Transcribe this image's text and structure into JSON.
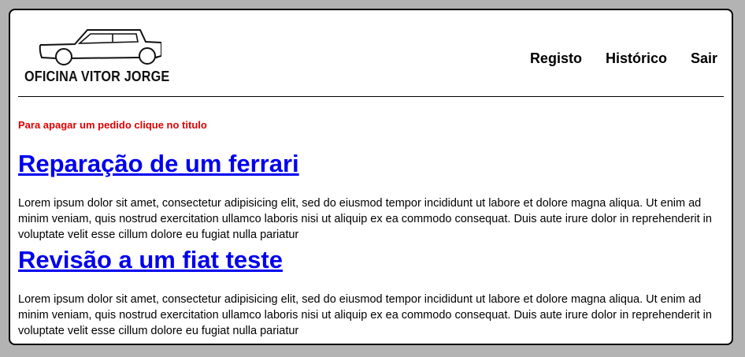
{
  "header": {
    "logo_text": "OFICINA VITOR JORGE",
    "logo_icon": "car-icon"
  },
  "nav": {
    "items": [
      "Registo",
      "Histórico",
      "Sair"
    ]
  },
  "notice": "Para apagar um pedido clique no titulo",
  "requests": [
    {
      "title": "Reparação de um ferrari",
      "body": "Lorem ipsum dolor sit amet, consectetur adipisicing elit, sed do eiusmod tempor incididunt ut labore et dolore magna aliqua. Ut enim ad minim veniam, quis nostrud exercitation ullamco laboris nisi ut aliquip ex ea commodo consequat. Duis aute irure dolor in reprehenderit in voluptate velit esse cillum dolore eu fugiat nulla pariatur"
    },
    {
      "title": "Revisão a um fiat teste",
      "body": "Lorem ipsum dolor sit amet, consectetur adipisicing elit, sed do eiusmod tempor incididunt ut labore et dolore magna aliqua. Ut enim ad minim veniam, quis nostrud exercitation ullamco laboris nisi ut aliquip ex ea commodo consequat. Duis aute irure dolor in reprehenderit in voluptate velit esse cillum dolore eu fugiat nulla pariatur"
    }
  ],
  "colors": {
    "background": "#b3b3b3",
    "card": "#ffffff",
    "notice": "#e00000",
    "link": "#0000ee"
  }
}
